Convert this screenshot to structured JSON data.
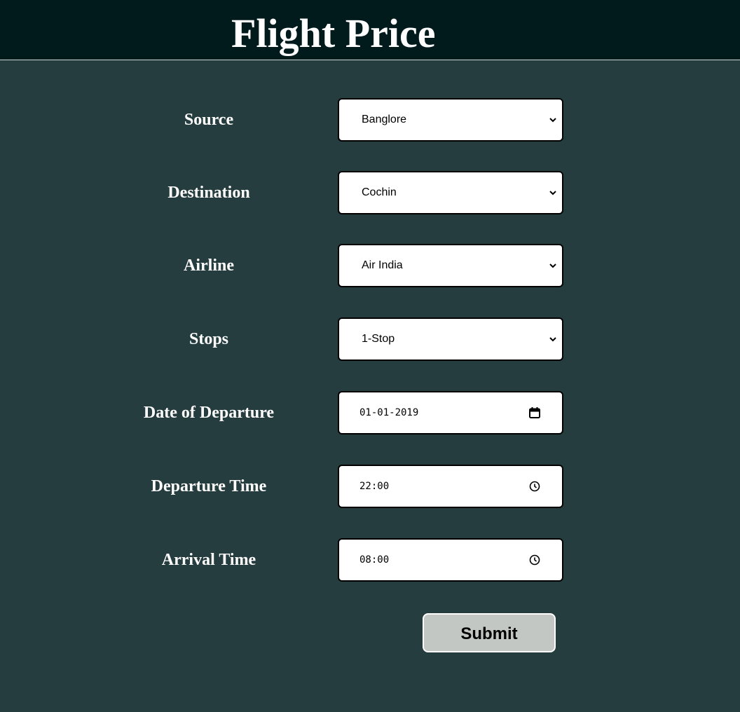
{
  "header": {
    "title": "Flight Price"
  },
  "form": {
    "source": {
      "label": "Source",
      "value": "Banglore",
      "icon": "chevron-down-icon"
    },
    "destination": {
      "label": "Destination",
      "value": "Cochin",
      "icon": "chevron-down-icon"
    },
    "airline": {
      "label": "Airline",
      "value": "Air India",
      "icon": "chevron-down-icon"
    },
    "stops": {
      "label": "Stops",
      "value": "1-Stop",
      "icon": "chevron-down-icon"
    },
    "date_of_departure": {
      "label": "Date of Departure",
      "value": "01-01-2019",
      "icon": "calendar-icon"
    },
    "departure_time": {
      "label": "Departure Time",
      "value": "22:00",
      "icon": "clock-icon"
    },
    "arrival_time": {
      "label": "Arrival Time",
      "value": "08:00",
      "icon": "clock-icon"
    },
    "submit_label": "Submit"
  },
  "colors": {
    "header_background": "#011a1c",
    "page_background": "#263d40",
    "field_background": "#ffffff",
    "submit_background": "#c3c7c4"
  }
}
